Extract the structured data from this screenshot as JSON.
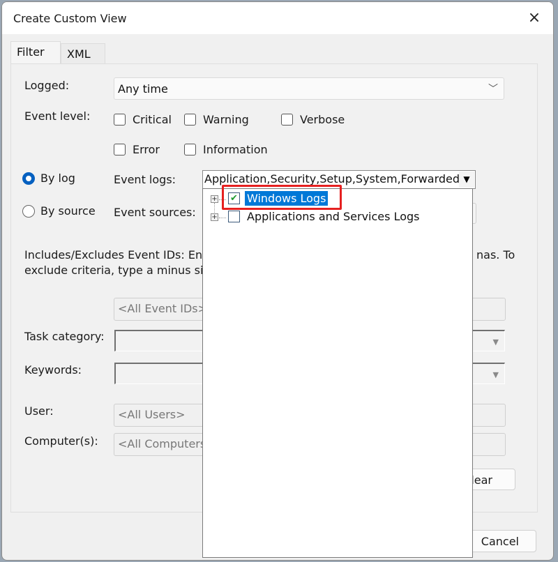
{
  "dialog": {
    "title": "Create Custom View",
    "close_icon": "×"
  },
  "tabs": [
    {
      "label": "Filter",
      "active": true
    },
    {
      "label": "XML",
      "active": false
    }
  ],
  "filter": {
    "logged_label": "Logged:",
    "logged_value": "Any time",
    "event_level_label": "Event level:",
    "levels": [
      {
        "label": "Critical",
        "checked": false
      },
      {
        "label": "Warning",
        "checked": false
      },
      {
        "label": "Verbose",
        "checked": false
      },
      {
        "label": "Error",
        "checked": false
      },
      {
        "label": "Information",
        "checked": false
      }
    ],
    "by_log_label": "By log",
    "by_source_label": "By source",
    "selected_mode": "By log",
    "event_logs_label": "Event logs:",
    "event_logs_value": "Application,Security,Setup,System,Forwarded E",
    "event_sources_label": "Event sources:",
    "event_ids_description_line1_visible": "Includes/Excludes Event IDs: Ente",
    "event_ids_description_line1_tail": "nas. To",
    "event_ids_description_line2_visible": "exclude criteria, type a minus sigr",
    "event_ids_placeholder": "<All Event IDs>",
    "task_category_label": "Task category:",
    "keywords_label": "Keywords:",
    "user_label": "User:",
    "user_placeholder": "<All Users>",
    "computers_label": "Computer(s):",
    "computers_placeholder": "<All Computers",
    "clear_button_visible": "lear"
  },
  "event_log_tree": {
    "items": [
      {
        "label": "Windows Logs",
        "checked": true,
        "selected": true,
        "check_glyph": "✔",
        "expander": "+"
      },
      {
        "label": "Applications and Services Logs",
        "checked": false,
        "selected": false,
        "check_glyph": "",
        "expander": "+"
      }
    ]
  },
  "footer": {
    "cancel_label": "Cancel"
  },
  "colors": {
    "selection": "#0078d7",
    "highlight_box": "#e52020",
    "radio_accent": "#0560c0"
  }
}
